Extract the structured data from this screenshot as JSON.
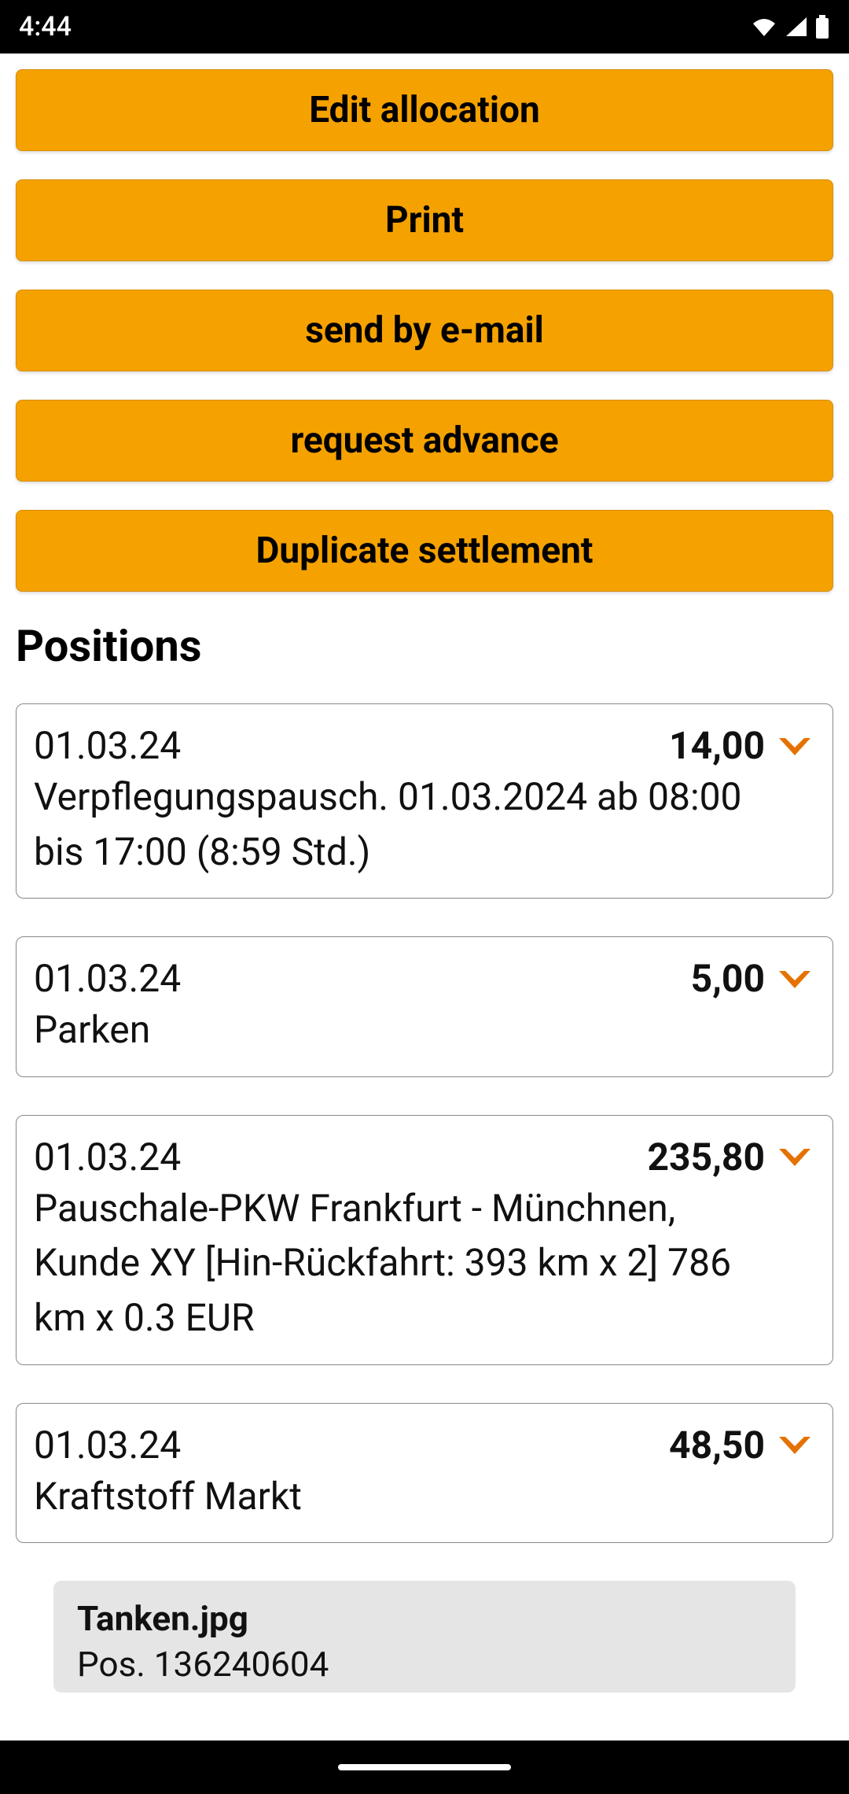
{
  "status": {
    "time": "4:44"
  },
  "buttons": {
    "edit_allocation": "Edit allocation",
    "print": "Print",
    "send_email": "send by e-mail",
    "request_advance": "request advance",
    "duplicate_settlement": "Duplicate settlement"
  },
  "section": {
    "positions_title": "Positions"
  },
  "positions": [
    {
      "date": "01.03.24",
      "amount": "14,00",
      "description": "Verpflegungspausch. 01.03.2024 ab 08:00 bis 17:00 (8:59 Std.)"
    },
    {
      "date": "01.03.24",
      "amount": "5,00",
      "description": "Parken"
    },
    {
      "date": "01.03.24",
      "amount": "235,80",
      "description": "Pauschale-PKW Frankfurt - Münchnen, Kunde XY [Hin-Rückfahrt: 393 km x 2] 786 km x 0.3 EUR"
    },
    {
      "date": "01.03.24",
      "amount": "48,50",
      "description": "Kraftstoff Markt"
    }
  ],
  "attachment": {
    "filename": "Tanken.jpg",
    "subline": "Pos. 136240604"
  }
}
